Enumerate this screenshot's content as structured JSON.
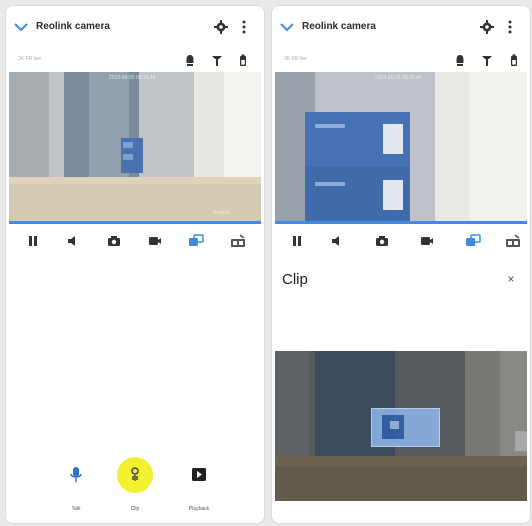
{
  "app": {
    "title": "Reolink camera",
    "subtitle": "2K FR live"
  },
  "video": {
    "overlay_top": "2023-06-05 08:15:44",
    "overlay_bottom": "Reolink"
  },
  "clip_panel": {
    "title": "Clip",
    "close": "×"
  },
  "bottom_bar": {
    "talk_label": "Talk",
    "clip_label": "Clip",
    "playback_label": "Playback"
  },
  "colors": {
    "accent": "#3f8be6",
    "highlight": "#f2f230",
    "box": "#2f6fd0"
  }
}
